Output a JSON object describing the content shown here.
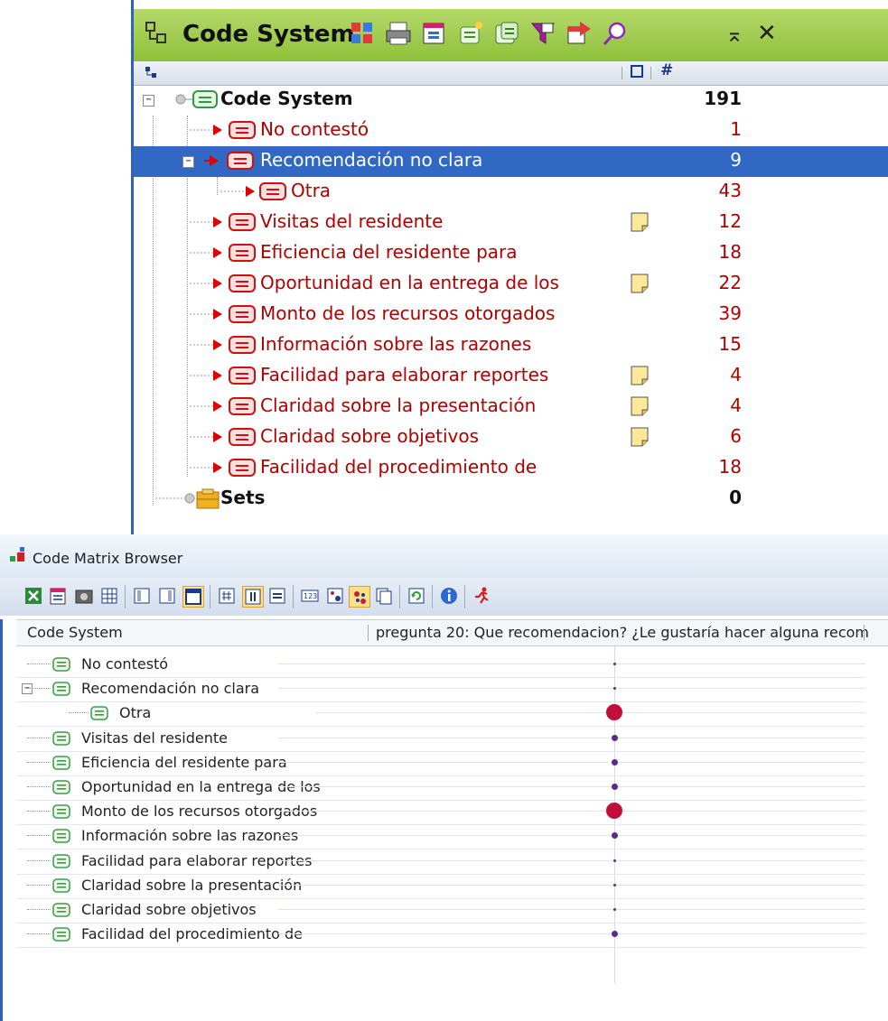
{
  "code_system_panel": {
    "title": "Code System",
    "toolbar_icons": [
      "code-matrix-icon",
      "print-icon",
      "export-icon",
      "new-code-icon",
      "import-icon",
      "filter-icon",
      "activate-icon",
      "search-icon"
    ],
    "collapse_label": "⌅",
    "close_label": "✕",
    "column_headers": {
      "memo": "memo-column-icon",
      "frequency": "#"
    },
    "rows": [
      {
        "label": "Code System",
        "count": "191"
      },
      {
        "label": "No contestó",
        "count": "1"
      },
      {
        "label": "Recomendación no clara",
        "count": "9"
      },
      {
        "label": "Otra",
        "count": "43"
      },
      {
        "label": "Visitas del residente",
        "count": "12"
      },
      {
        "label": "Eficiencia del residente para",
        "count": "18"
      },
      {
        "label": "Oportunidad en la entrega de los",
        "count": "22"
      },
      {
        "label": "Monto de los recursos otorgados",
        "count": "39"
      },
      {
        "label": "Información sobre las razones",
        "count": "15"
      },
      {
        "label": "Facilidad para elaborar reportes",
        "count": "4"
      },
      {
        "label": "Claridad sobre la presentación",
        "count": "4"
      },
      {
        "label": "Claridad sobre objetivos",
        "count": "6"
      },
      {
        "label": "Facilidad del procedimiento de",
        "count": "18"
      },
      {
        "label": "Sets",
        "count": "0"
      }
    ]
  },
  "matrix_browser": {
    "title": "Code Matrix Browser",
    "column_code_system": "Code System",
    "column_document": "pregunta 20: Que recomendacion? ¿Le gustaría hacer alguna recom",
    "rows": [
      {
        "label": "No contestó",
        "size": 1
      },
      {
        "label": "Recomendación no clara",
        "size": 1
      },
      {
        "label": "Otra",
        "size": 4
      },
      {
        "label": "Visitas del residente",
        "size": 2
      },
      {
        "label": "Eficiencia del residente para",
        "size": 2
      },
      {
        "label": "Oportunidad en la entrega de los",
        "size": 2
      },
      {
        "label": "Monto de los recursos otorgados",
        "size": 4
      },
      {
        "label": "Información sobre las razones",
        "size": 2
      },
      {
        "label": "Facilidad para elaborar reportes",
        "size": 1
      },
      {
        "label": "Claridad sobre la presentación",
        "size": 1
      },
      {
        "label": "Claridad sobre objetivos",
        "size": 1
      },
      {
        "label": "Facilidad del procedimiento de",
        "size": 2
      }
    ]
  },
  "colors": {
    "header_green": "#8fc03a",
    "selection_blue": "#3168c4",
    "code_red": "#b00000",
    "dot_small": "#5a2a8a",
    "dot_large": "#c0103a"
  }
}
